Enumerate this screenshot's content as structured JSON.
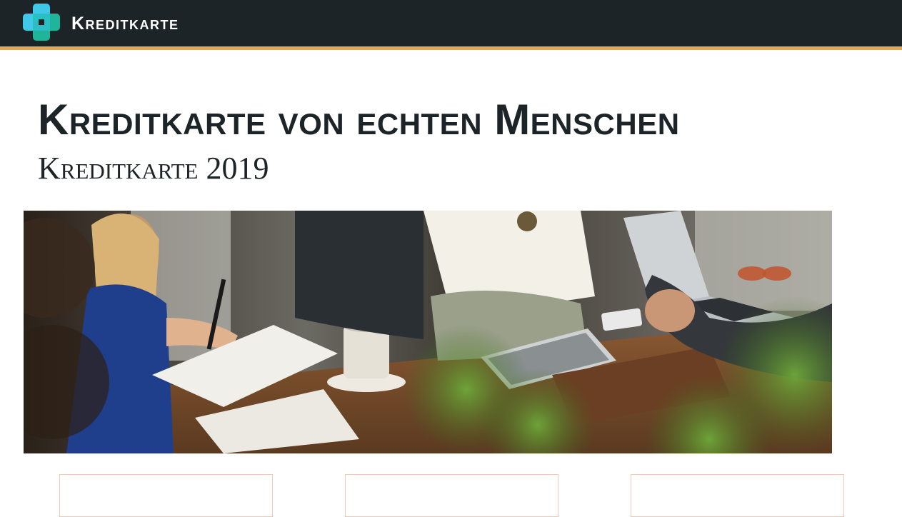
{
  "header": {
    "brand_name": "Kreditkarte",
    "logo_icon": "medical-cross-logo-icon",
    "colors": {
      "bar_background": "#1c2428",
      "accent_stripe": "#e4a853",
      "logo_light": "#3fc8e8",
      "logo_dark": "#1fb59a"
    }
  },
  "hero": {
    "title": "Kreditkarte von echten Menschen",
    "subtitle": "Kreditkarte 2019",
    "image_description_icon": "team-meeting-photo"
  },
  "cards": [
    {
      "name": "card-1"
    },
    {
      "name": "card-2"
    },
    {
      "name": "card-3"
    }
  ]
}
